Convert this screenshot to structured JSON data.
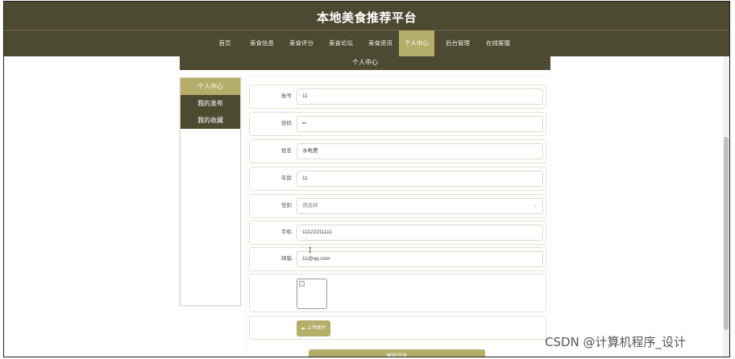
{
  "site": {
    "title": "本地美食推荐平台"
  },
  "nav": [
    {
      "label": "首页"
    },
    {
      "label": "美食信息"
    },
    {
      "label": "美食评分"
    },
    {
      "label": "美食论坛"
    },
    {
      "label": "美食资讯"
    },
    {
      "label": "个人中心",
      "active": true
    },
    {
      "label": "后台管理"
    },
    {
      "label": "在线客服"
    }
  ],
  "subhead": "个人中心",
  "sidebar": [
    {
      "label": "个人中心",
      "active": true
    },
    {
      "label": "我的发布"
    },
    {
      "label": "我的收藏"
    }
  ],
  "form": {
    "account": {
      "label": "账号",
      "value": "11"
    },
    "password": {
      "label": "密码",
      "value": "••"
    },
    "name": {
      "label": "姓名",
      "value": "水电费"
    },
    "age": {
      "label": "年龄",
      "value": "11"
    },
    "gender": {
      "label": "性别",
      "value": "请选择"
    },
    "phone": {
      "label": "手机",
      "value": "11122211111"
    },
    "email": {
      "label": "邮箱",
      "value": "11@qq.com"
    },
    "upload_label": "上传图片",
    "submit_label": "更新信息"
  },
  "watermark": "CSDN @计算机程序_设计",
  "colors": {
    "nav_bg": "#4d4a32",
    "accent": "#b5ad6a"
  },
  "icons": {
    "upload": "cloud-upload-icon",
    "select": "chevron-down-icon",
    "image": "broken-image-icon"
  }
}
